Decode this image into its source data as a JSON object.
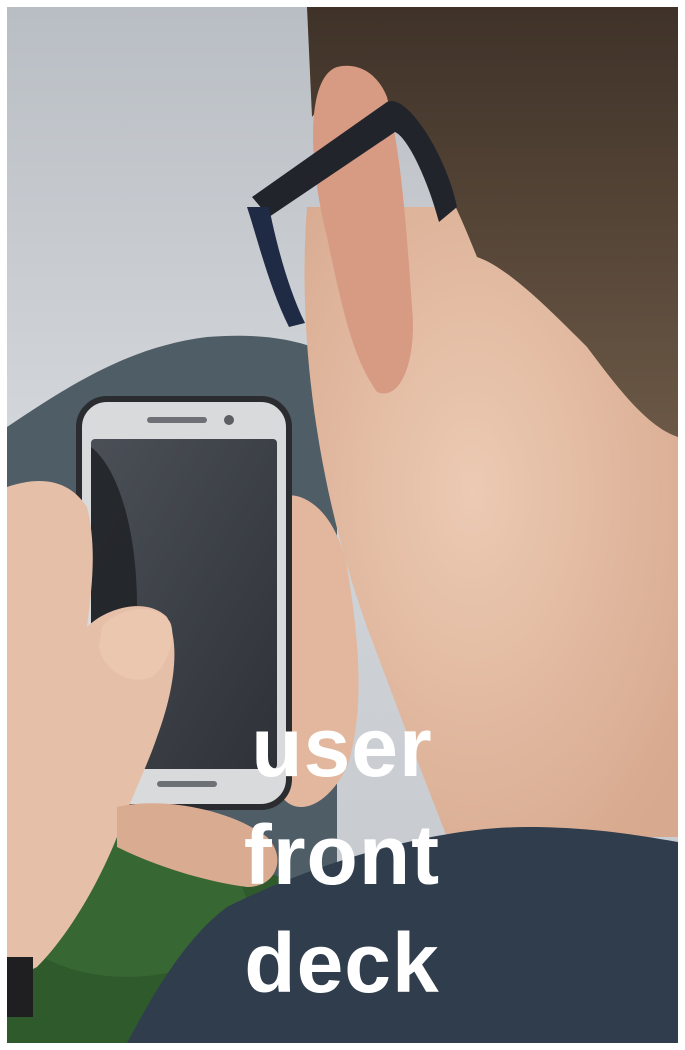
{
  "caption": {
    "lines": [
      "user",
      "front",
      "deck"
    ],
    "color": "#ffffff"
  },
  "photo": {
    "subject": "person-with-glasses-holding-smartphone",
    "colors": {
      "sky": "#c9cdd2",
      "mountain": "#4f5d66",
      "foliage": "#2f5a2c",
      "skin": "#e6bfa8",
      "hair": "#5a4a3c",
      "shirt": "#2f3d4d",
      "phone_body": "#d9dadb",
      "phone_screen": "#3c4047",
      "glasses": "#22242c"
    }
  }
}
